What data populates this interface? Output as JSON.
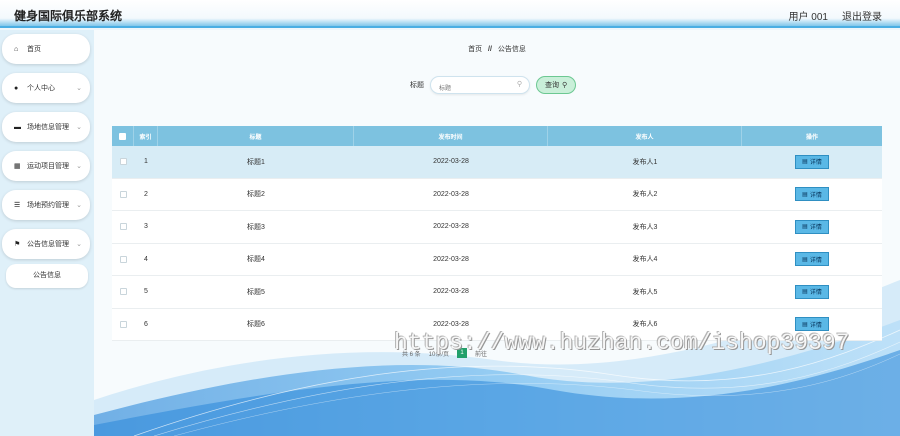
{
  "app": {
    "title": "健身国际俱乐部系统"
  },
  "header": {
    "user": "用户 001",
    "logout": "退出登录"
  },
  "sidebar": {
    "items": [
      {
        "label": "首页",
        "icon": "home-icon",
        "glyph": "⌂",
        "has_chevron": false
      },
      {
        "label": "个人中心",
        "icon": "user-icon",
        "glyph": "👤",
        "has_chevron": true
      },
      {
        "label": "场地信息管理",
        "icon": "monitor-icon",
        "glyph": "▬",
        "has_chevron": true
      },
      {
        "label": "运动项目管理",
        "icon": "grid-icon",
        "glyph": "▦",
        "has_chevron": true
      },
      {
        "label": "场地预约管理",
        "icon": "sliders-icon",
        "glyph": "☰",
        "has_chevron": true
      },
      {
        "label": "公告信息管理",
        "icon": "flag-icon",
        "glyph": "⚑",
        "has_chevron": true
      }
    ],
    "sub_item": "公告信息"
  },
  "breadcrumb": {
    "home": "首页",
    "sep": "//",
    "current": "公告信息"
  },
  "search": {
    "label": "标题",
    "placeholder": "标题",
    "button": "查询"
  },
  "table": {
    "headers": {
      "index": "索引",
      "title": "标题",
      "date": "发布时间",
      "publisher": "发布人",
      "actions": "操作"
    },
    "rows": [
      {
        "index": "1",
        "title": "标题1",
        "date": "2022-03-28",
        "publisher": "发布人1",
        "action": "详情"
      },
      {
        "index": "2",
        "title": "标题2",
        "date": "2022-03-28",
        "publisher": "发布人2",
        "action": "详情"
      },
      {
        "index": "3",
        "title": "标题3",
        "date": "2022-03-28",
        "publisher": "发布人3",
        "action": "详情"
      },
      {
        "index": "4",
        "title": "标题4",
        "date": "2022-03-28",
        "publisher": "发布人4",
        "action": "详情"
      },
      {
        "index": "5",
        "title": "标题5",
        "date": "2022-03-28",
        "publisher": "发布人5",
        "action": "详情"
      },
      {
        "index": "6",
        "title": "标题6",
        "date": "2022-03-28",
        "publisher": "发布人6",
        "action": "详情"
      }
    ]
  },
  "pagination": {
    "total": "共 6 条",
    "page_size": "10条/页",
    "current": "1",
    "goto": "前往"
  },
  "watermark": "https://www.huzhan.com/ishop39397",
  "colors": {
    "accent": "#4aaee3",
    "header_row": "#7dc2e0",
    "selected_row": "#d7ecf6",
    "search_button": "#c9efd9",
    "page_active": "#22a06b"
  }
}
